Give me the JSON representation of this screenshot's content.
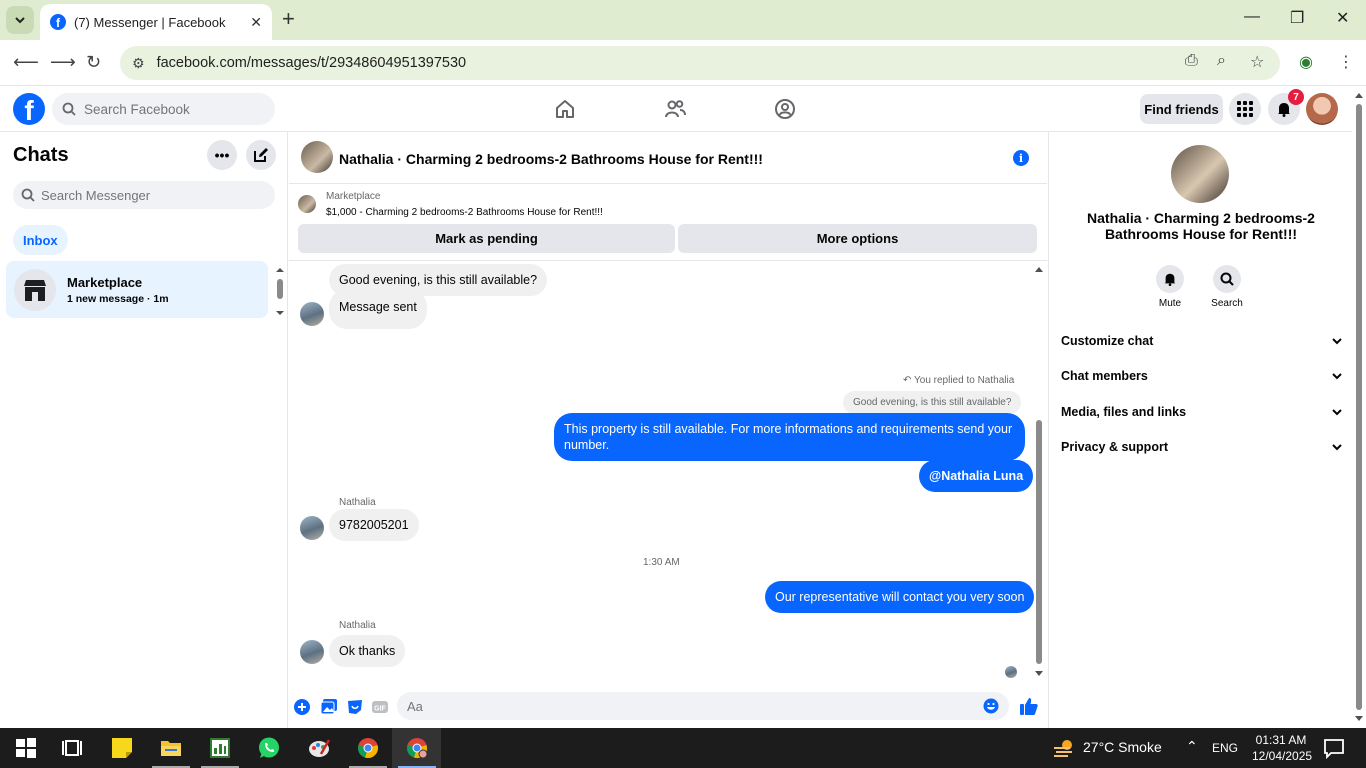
{
  "browser": {
    "tab_title": "(7) Messenger | Facebook",
    "url": "facebook.com/messages/t/29348604951397530"
  },
  "fb": {
    "search_placeholder": "Search Facebook",
    "find_friends": "Find friends",
    "notification_count": "7"
  },
  "sidebar": {
    "title": "Chats",
    "search_placeholder": "Search Messenger",
    "inbox_label": "Inbox",
    "chats": [
      {
        "name": "Marketplace",
        "subtitle": "1 new message · 1m"
      }
    ]
  },
  "conversation": {
    "title": "Nathalia · Charming 2 bedrooms-2 Bathrooms House for Rent!!!",
    "marketplace": {
      "label": "Marketplace",
      "listing": "$1,000 - Charming 2 bedrooms-2 Bathrooms House for Rent!!!",
      "mark_pending": "Mark as pending",
      "more_options": "More options"
    },
    "messages": {
      "m1": "Good evening, is this still available?",
      "m2": "Message sent",
      "reply_note": "You replied to Nathalia",
      "quoted": "Good evening, is this still available?",
      "m3": "This property is still available. For more informations and requirements send your number.",
      "m4": "@Nathalia Luna",
      "sender1": "Nathalia",
      "m5": "9782005201",
      "timestamp": "1:30 AM",
      "m6": "Our representative will contact you very soon",
      "sender2": "Nathalia",
      "m7": "Ok thanks"
    },
    "composer_placeholder": "Aa"
  },
  "right_panel": {
    "name": "Nathalia · Charming 2 bedrooms-2 Bathrooms House for Rent!!!",
    "mute_label": "Mute",
    "search_label": "Search",
    "sections": [
      "Customize chat",
      "Chat members",
      "Media, files and links",
      "Privacy & support"
    ]
  },
  "taskbar": {
    "weather": "27°C  Smoke",
    "lang": "ENG",
    "time": "01:31 AM",
    "date": "12/04/2025"
  },
  "colors": {
    "fb_blue": "#0866ff",
    "chrome_green": "#dfeccf",
    "bubble_in": "#f0f0f0"
  }
}
